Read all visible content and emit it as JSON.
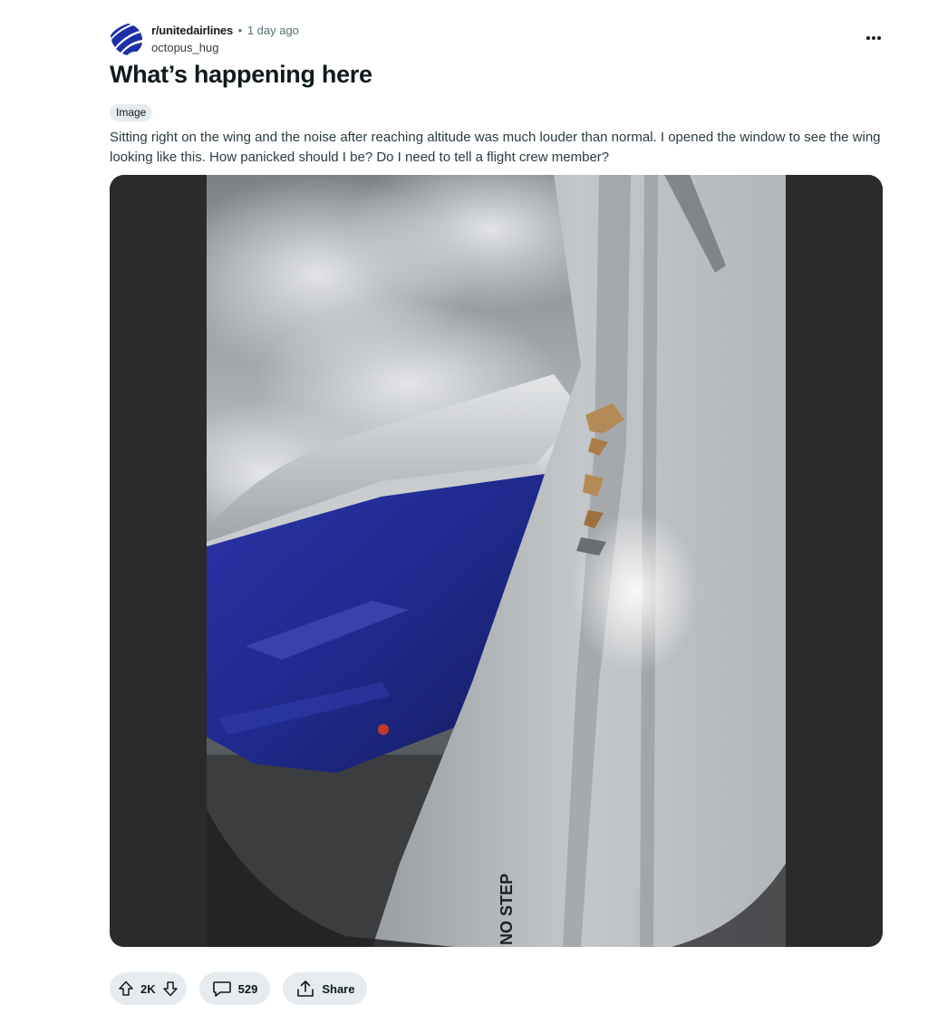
{
  "post": {
    "subreddit": "r/unitedairlines",
    "separator": "•",
    "time": "1 day ago",
    "author": "octopus_hug",
    "title": "What’s happening here",
    "flair": "Image",
    "body": "Sitting right on the wing and the noise after reaching altitude was much louder than normal. I opened the window to see the wing looking like this. How panicked should I be? Do I need to tell a flight crew member?",
    "image_text": "NO STEP"
  },
  "actions": {
    "vote_count": "2K",
    "comment_count": "529",
    "share_label": "Share"
  },
  "icons": {
    "overflow": "more-icon",
    "upvote": "arrow-up-icon",
    "downvote": "arrow-down-icon",
    "comments": "comment-bubble-icon",
    "share": "share-icon"
  },
  "colors": {
    "pill_bg": "#e5ebee",
    "text": "#0f1a1c",
    "avatar_blue": "#1e2fa8"
  }
}
